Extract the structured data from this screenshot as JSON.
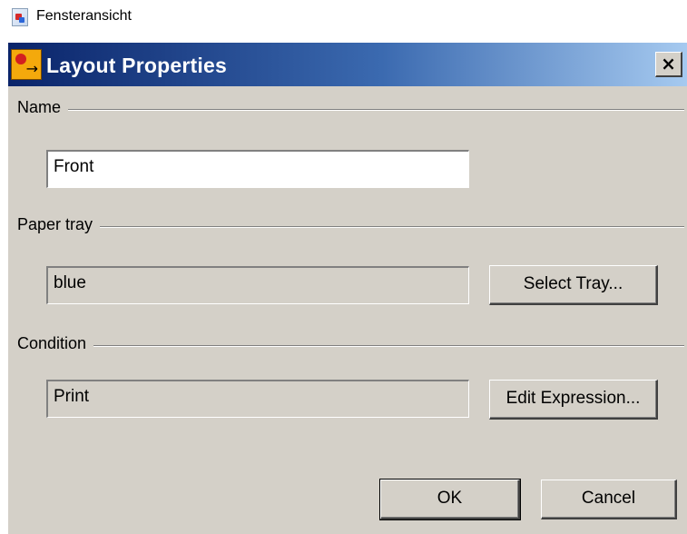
{
  "outer_window": {
    "title": "Fensteransicht"
  },
  "dialog": {
    "title": "Layout Properties",
    "close_label": "×",
    "name": {
      "label": "Name",
      "value": "Front"
    },
    "paper_tray": {
      "label": "Paper tray",
      "value": "blue",
      "button": "Select Tray..."
    },
    "condition": {
      "label": "Condition",
      "value": "Print",
      "button": "Edit Expression..."
    },
    "ok_label": "OK",
    "cancel_label": "Cancel"
  }
}
